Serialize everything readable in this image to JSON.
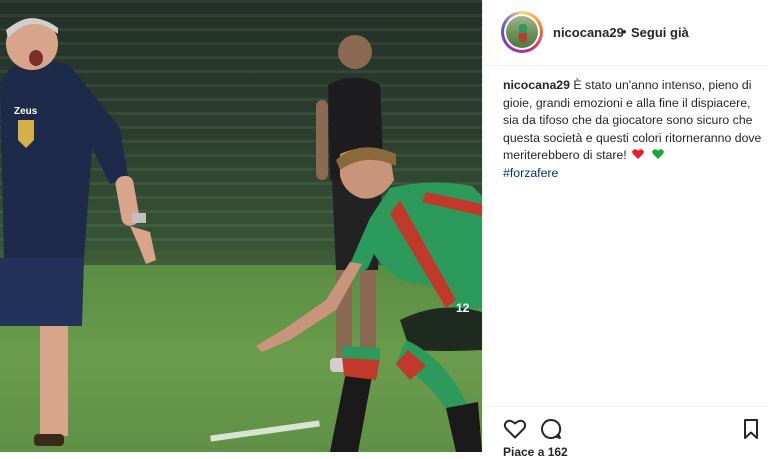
{
  "post": {
    "username": "nicocana29",
    "separator": "•",
    "follow_status": "Segui già",
    "caption_user": "nicocana29",
    "caption_text": "È stato un'anno intenso, pieno di gioie, grandi emozioni e alla fine il dispiacere, sia da tifoso che da giocatore sono sicuro che questa società e questi colori ritorneranno dove meriterebbero di stare!",
    "hashtag": "#forzafere",
    "likes_peek": "Piace a 162"
  },
  "photo": {
    "coach_shirt_text": "Zeus",
    "player_number": "12"
  },
  "icons": {
    "heart_red": "#ed1c24",
    "heart_green": "#16a93b",
    "like": "heart-outline-icon",
    "comment": "comment-icon",
    "save": "bookmark-icon"
  }
}
